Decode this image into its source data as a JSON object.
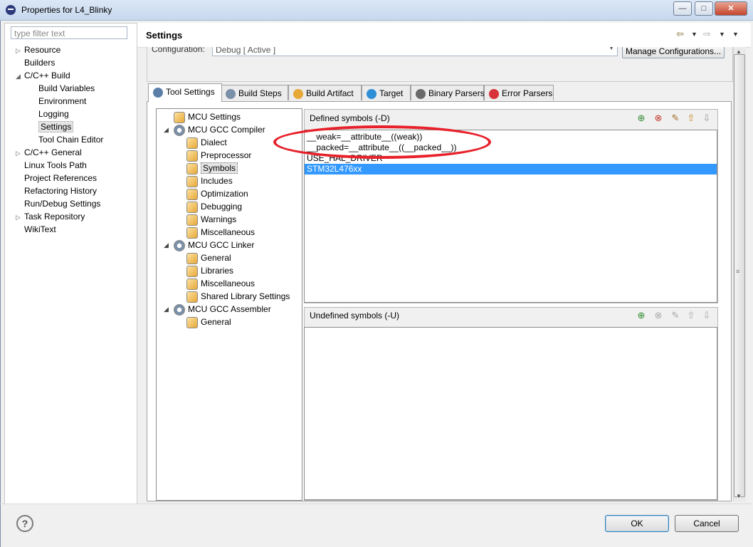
{
  "window": {
    "title": "Properties for L4_Blinky",
    "controls": [
      "—",
      "□",
      "✕"
    ]
  },
  "filter": {
    "placeholder": "type filter text"
  },
  "nav": {
    "items": [
      {
        "label": "Resource",
        "level": 0,
        "arrow": "▷"
      },
      {
        "label": "Builders",
        "level": 0,
        "arrow": ""
      },
      {
        "label": "C/C++ Build",
        "level": 0,
        "arrow": "◢"
      },
      {
        "label": "Build Variables",
        "level": 1,
        "arrow": ""
      },
      {
        "label": "Environment",
        "level": 1,
        "arrow": ""
      },
      {
        "label": "Logging",
        "level": 1,
        "arrow": ""
      },
      {
        "label": "Settings",
        "level": 1,
        "arrow": "",
        "selected": true
      },
      {
        "label": "Tool Chain Editor",
        "level": 1,
        "arrow": ""
      },
      {
        "label": "C/C++ General",
        "level": 0,
        "arrow": "▷"
      },
      {
        "label": "Linux Tools Path",
        "level": 0,
        "arrow": ""
      },
      {
        "label": "Project References",
        "level": 0,
        "arrow": ""
      },
      {
        "label": "Refactoring History",
        "level": 0,
        "arrow": ""
      },
      {
        "label": "Run/Debug Settings",
        "level": 0,
        "arrow": ""
      },
      {
        "label": "Task Repository",
        "level": 0,
        "arrow": "▷"
      },
      {
        "label": "WikiText",
        "level": 0,
        "arrow": ""
      }
    ]
  },
  "header": {
    "title": "Settings",
    "config_label": "Configuration:",
    "config_value": "Debug  [ Active ]",
    "manage_button": "Manage Configurations..."
  },
  "tabs": [
    {
      "label": "Tool Settings",
      "active": true,
      "color": "#5b7fa8"
    },
    {
      "label": "Build Steps",
      "active": false,
      "color": "#7a8fa8"
    },
    {
      "label": "Build Artifact",
      "active": false,
      "color": "#e6a837"
    },
    {
      "label": "Target",
      "active": false,
      "color": "#2f8fd6"
    },
    {
      "label": "Binary Parsers",
      "active": false,
      "color": "#6a6a6a"
    },
    {
      "label": "Error Parsers",
      "active": false,
      "color": "#d8333a"
    }
  ],
  "tool_tree": [
    {
      "label": "MCU Settings",
      "level": 1,
      "icon": "folder-icon"
    },
    {
      "label": "MCU GCC Compiler",
      "level": 0,
      "icon": "gear-icon",
      "expanded": true
    },
    {
      "label": "Dialect",
      "level": 2,
      "icon": "folder-icon"
    },
    {
      "label": "Preprocessor",
      "level": 2,
      "icon": "folder-icon"
    },
    {
      "label": "Symbols",
      "level": 2,
      "icon": "folder-icon",
      "selected": true
    },
    {
      "label": "Includes",
      "level": 2,
      "icon": "folder-icon"
    },
    {
      "label": "Optimization",
      "level": 2,
      "icon": "folder-icon"
    },
    {
      "label": "Debugging",
      "level": 2,
      "icon": "folder-icon"
    },
    {
      "label": "Warnings",
      "level": 2,
      "icon": "folder-icon"
    },
    {
      "label": "Miscellaneous",
      "level": 2,
      "icon": "folder-icon"
    },
    {
      "label": "MCU GCC Linker",
      "level": 0,
      "icon": "gear-icon",
      "expanded": true
    },
    {
      "label": "General",
      "level": 2,
      "icon": "folder-icon"
    },
    {
      "label": "Libraries",
      "level": 2,
      "icon": "folder-icon"
    },
    {
      "label": "Miscellaneous",
      "level": 2,
      "icon": "folder-icon"
    },
    {
      "label": "Shared Library Settings",
      "level": 2,
      "icon": "folder-icon"
    },
    {
      "label": "MCU GCC Assembler",
      "level": 0,
      "icon": "gear-icon",
      "expanded": true
    },
    {
      "label": "General",
      "level": 2,
      "icon": "folder-icon"
    }
  ],
  "defined_symbols": {
    "title": "Defined symbols (-D)",
    "items": [
      {
        "text": "__weak=__attribute__((weak))",
        "selected": false
      },
      {
        "text": "__packed=__attribute__((__packed__))",
        "selected": false
      },
      {
        "text": "USE_HAL_DRIVER",
        "selected": false
      },
      {
        "text": "STM32L476xx",
        "selected": true
      }
    ]
  },
  "undefined_symbols": {
    "title": "Undefined symbols (-U)",
    "items": []
  },
  "footer": {
    "help": "?",
    "ok": "OK",
    "cancel": "Cancel"
  },
  "colors": {
    "selection": "#3399ff",
    "annotation": "#e8202a"
  }
}
